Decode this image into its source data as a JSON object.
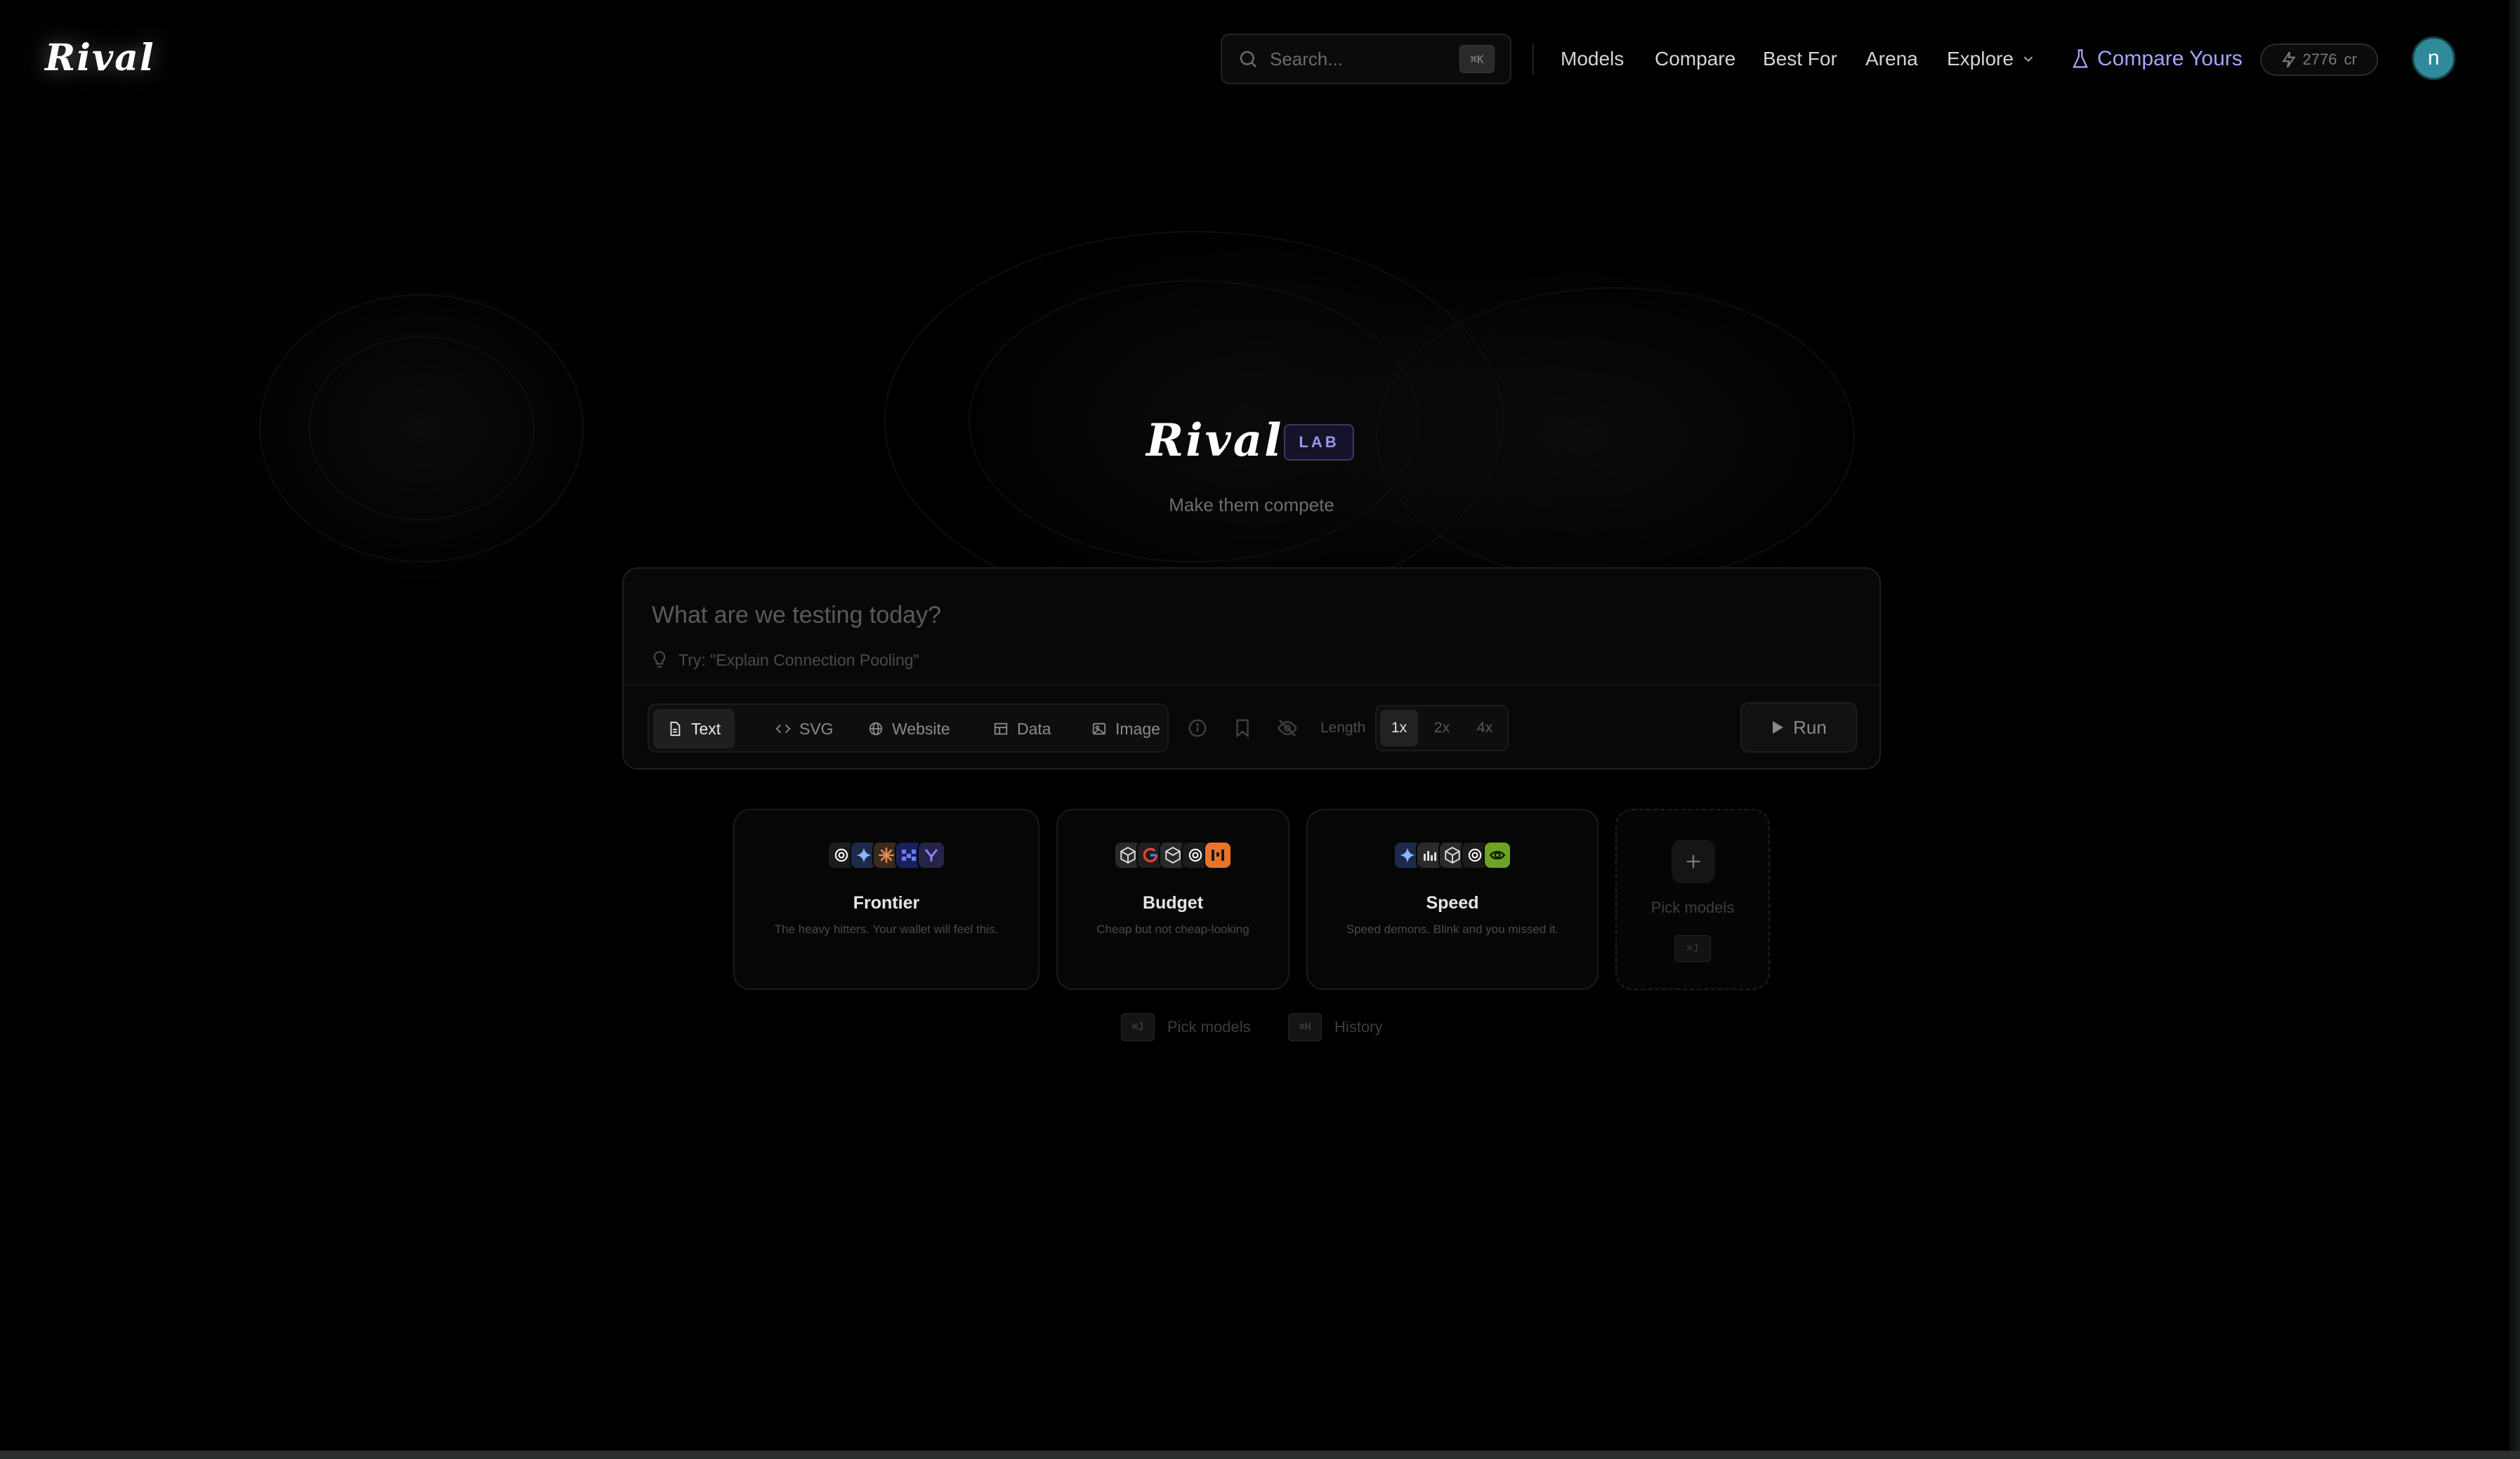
{
  "header": {
    "logo": "Rival",
    "search": {
      "placeholder": "Search...",
      "shortcut": "⌘K"
    },
    "nav": {
      "models": "Models",
      "compare": "Compare",
      "best_for": "Best For",
      "arena": "Arena",
      "explore": "Explore"
    },
    "compare_yours": "Compare Yours",
    "credits": {
      "value": "2776",
      "unit": "cr"
    },
    "avatar_initial": "n"
  },
  "hero": {
    "logo": "Rival",
    "badge": "LAB",
    "tagline": "Make them compete"
  },
  "prompt": {
    "placeholder": "What are we testing today?",
    "hint": "Try: \"Explain Connection Pooling\"",
    "modes": [
      "Text",
      "SVG",
      "Website",
      "Data",
      "Image"
    ],
    "active_mode": "Text",
    "length_label": "Length",
    "length_options": [
      "1x",
      "2x",
      "4x"
    ],
    "active_length": "1x",
    "run_label": "Run"
  },
  "presets": [
    {
      "title": "Frontier",
      "description": "The heavy hitters. Your wallet will feel this."
    },
    {
      "title": "Budget",
      "description": "Cheap but not cheap-looking"
    },
    {
      "title": "Speed",
      "description": "Speed demons. Blink and you missed it."
    }
  ],
  "pick_card": {
    "label": "Pick models",
    "shortcut": "⌘J"
  },
  "shortcuts": [
    {
      "key": "⌘J",
      "label": "Pick models"
    },
    {
      "key": "⌘H",
      "label": "History"
    }
  ],
  "colors": {
    "background": "#000000",
    "accent": "#a6a4ff",
    "avatar": "#2f8a9a"
  },
  "icons": {
    "search": "search-icon",
    "explore": "chevron-down-icon",
    "compare_yours": "flask-icon",
    "credits": "lightning-icon",
    "hint": "lightbulb-icon",
    "run": "play-icon",
    "pick": "plus-icon"
  }
}
